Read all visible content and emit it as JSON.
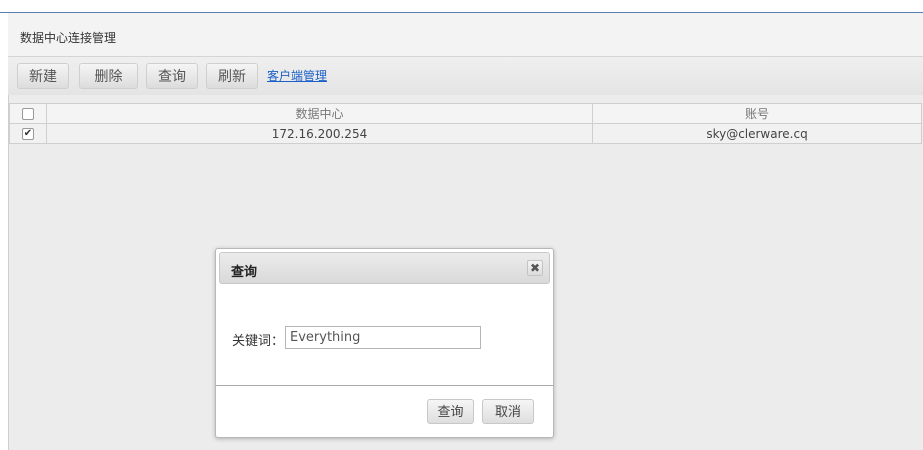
{
  "header": {
    "title": "数据中心连接管理"
  },
  "toolbar": {
    "new_label": "新建",
    "delete_label": "删除",
    "query_label": "查询",
    "refresh_label": "刷新",
    "client_link_label": "客户端管理"
  },
  "table": {
    "columns": [
      "数据中心",
      "账号"
    ],
    "rows": [
      {
        "checked": true,
        "datacenter": "172.16.200.254",
        "account": "sky@clerware.cq"
      }
    ]
  },
  "dialog": {
    "title": "查询",
    "close_glyph": "✖",
    "keyword_label": "关键词：",
    "keyword_value": "Everything",
    "query_label": "查询",
    "cancel_label": "取消"
  }
}
